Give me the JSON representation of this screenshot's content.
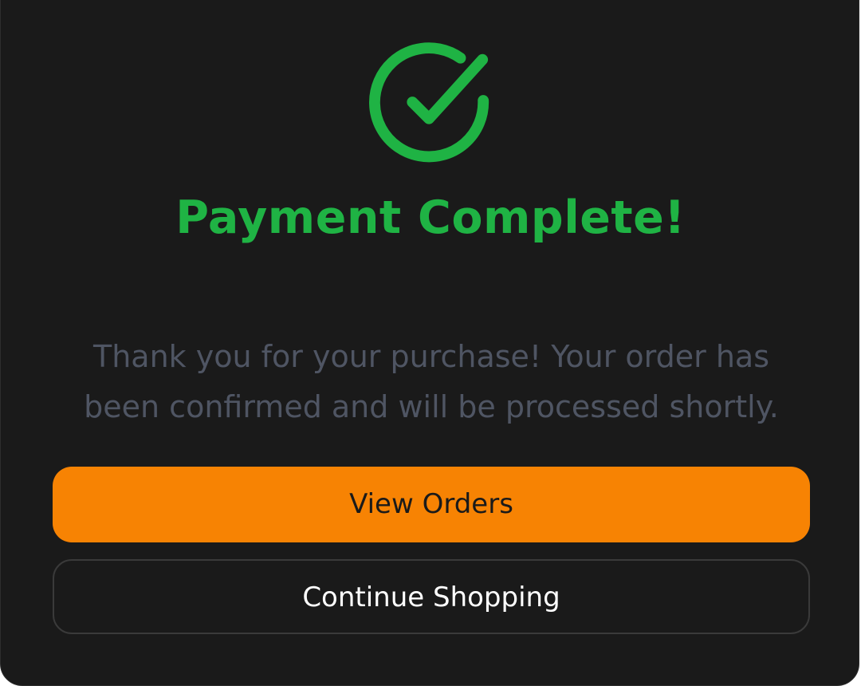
{
  "icon": {
    "name": "check-circle-icon",
    "color": "#1fb344"
  },
  "title": "Payment Complete!",
  "message": {
    "line1": "Thank you for your purchase! Your order has",
    "line2": "been confirmed and will be processed shortly."
  },
  "buttons": {
    "primary_label": "View Orders",
    "secondary_label": "Continue Shopping"
  },
  "colors": {
    "background": "#1a1a1a",
    "accent": "#f78303",
    "success": "#1fb344",
    "muted_text": "#4f5563"
  }
}
